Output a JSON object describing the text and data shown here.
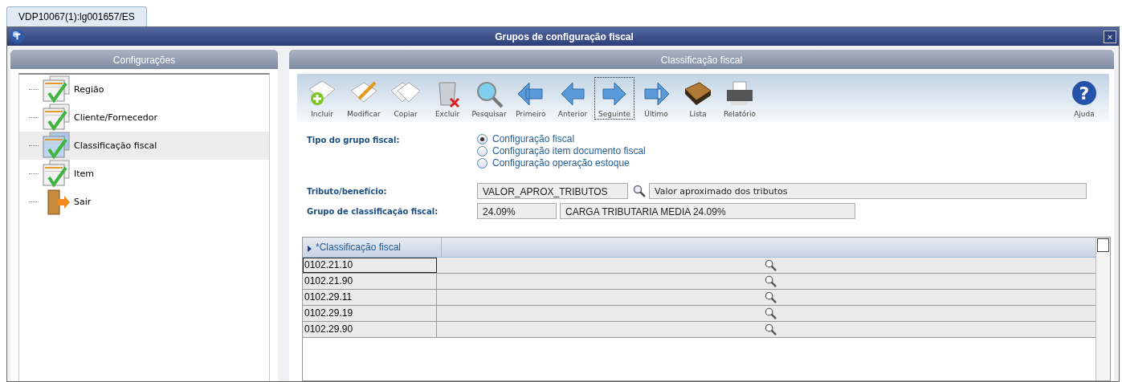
{
  "tab": {
    "label": "VDP10067(1):lg001657/ES",
    "selected": true
  },
  "window": {
    "title": "Grupos de configuração fiscal",
    "close": "×"
  },
  "sidebar": {
    "title": "Configurações",
    "items": [
      {
        "label": "Região",
        "kind": "config",
        "selected": false
      },
      {
        "label": "Cliente/Fornecedor",
        "kind": "config",
        "selected": false
      },
      {
        "label": "Classificação fiscal",
        "kind": "config",
        "selected": true
      },
      {
        "label": "Item",
        "kind": "config",
        "selected": false
      },
      {
        "label": "Sair",
        "kind": "exit",
        "selected": false
      }
    ]
  },
  "main": {
    "title": "Classificação fiscal"
  },
  "toolbar": [
    {
      "label": "Incluir",
      "kind": "add",
      "focused": false
    },
    {
      "label": "Modificar",
      "kind": "edit",
      "focused": false
    },
    {
      "label": "Copiar",
      "kind": "copy",
      "focused": false
    },
    {
      "label": "Excluir",
      "kind": "delete",
      "focused": false
    },
    {
      "label": "Pesquisar",
      "kind": "search",
      "focused": false
    },
    {
      "label": "Primeiro",
      "kind": "first",
      "focused": false
    },
    {
      "label": "Anterior",
      "kind": "prev",
      "focused": false
    },
    {
      "label": "Seguinte",
      "kind": "next",
      "focused": true
    },
    {
      "label": "Último",
      "kind": "last",
      "focused": false
    },
    {
      "label": "Lista",
      "kind": "book",
      "focused": false
    },
    {
      "label": "Relatório",
      "kind": "print",
      "focused": false
    }
  ],
  "help": {
    "icon": "?",
    "label": "Ajuda"
  },
  "form": {
    "type_label": "Tipo do grupo fiscal:",
    "options": [
      {
        "label": "Configuração fiscal",
        "selected": true
      },
      {
        "label": "Configuração item documento fiscal",
        "selected": false
      },
      {
        "label": "Configuração operação estoque",
        "selected": false
      }
    ],
    "tributo_label": "Tributo/benefício:",
    "tributo_code": "VALOR_APROX_TRIBUTOS",
    "tributo_desc": "Valor aproximado dos tributos",
    "grupo_label": "Grupo de classificação fiscal:",
    "grupo_code": "24.09%",
    "grupo_desc": "CARGA TRIBUTARIA MEDIA 24.09%"
  },
  "table": {
    "columns": [
      "*Classificação fiscal"
    ],
    "rows": [
      {
        "code": "0102.21.10",
        "selected": true
      },
      {
        "code": "0102.21.90",
        "selected": false
      },
      {
        "code": "0102.29.11",
        "selected": false
      },
      {
        "code": "0102.29.19",
        "selected": false
      },
      {
        "code": "0102.29.90",
        "selected": false
      }
    ]
  }
}
